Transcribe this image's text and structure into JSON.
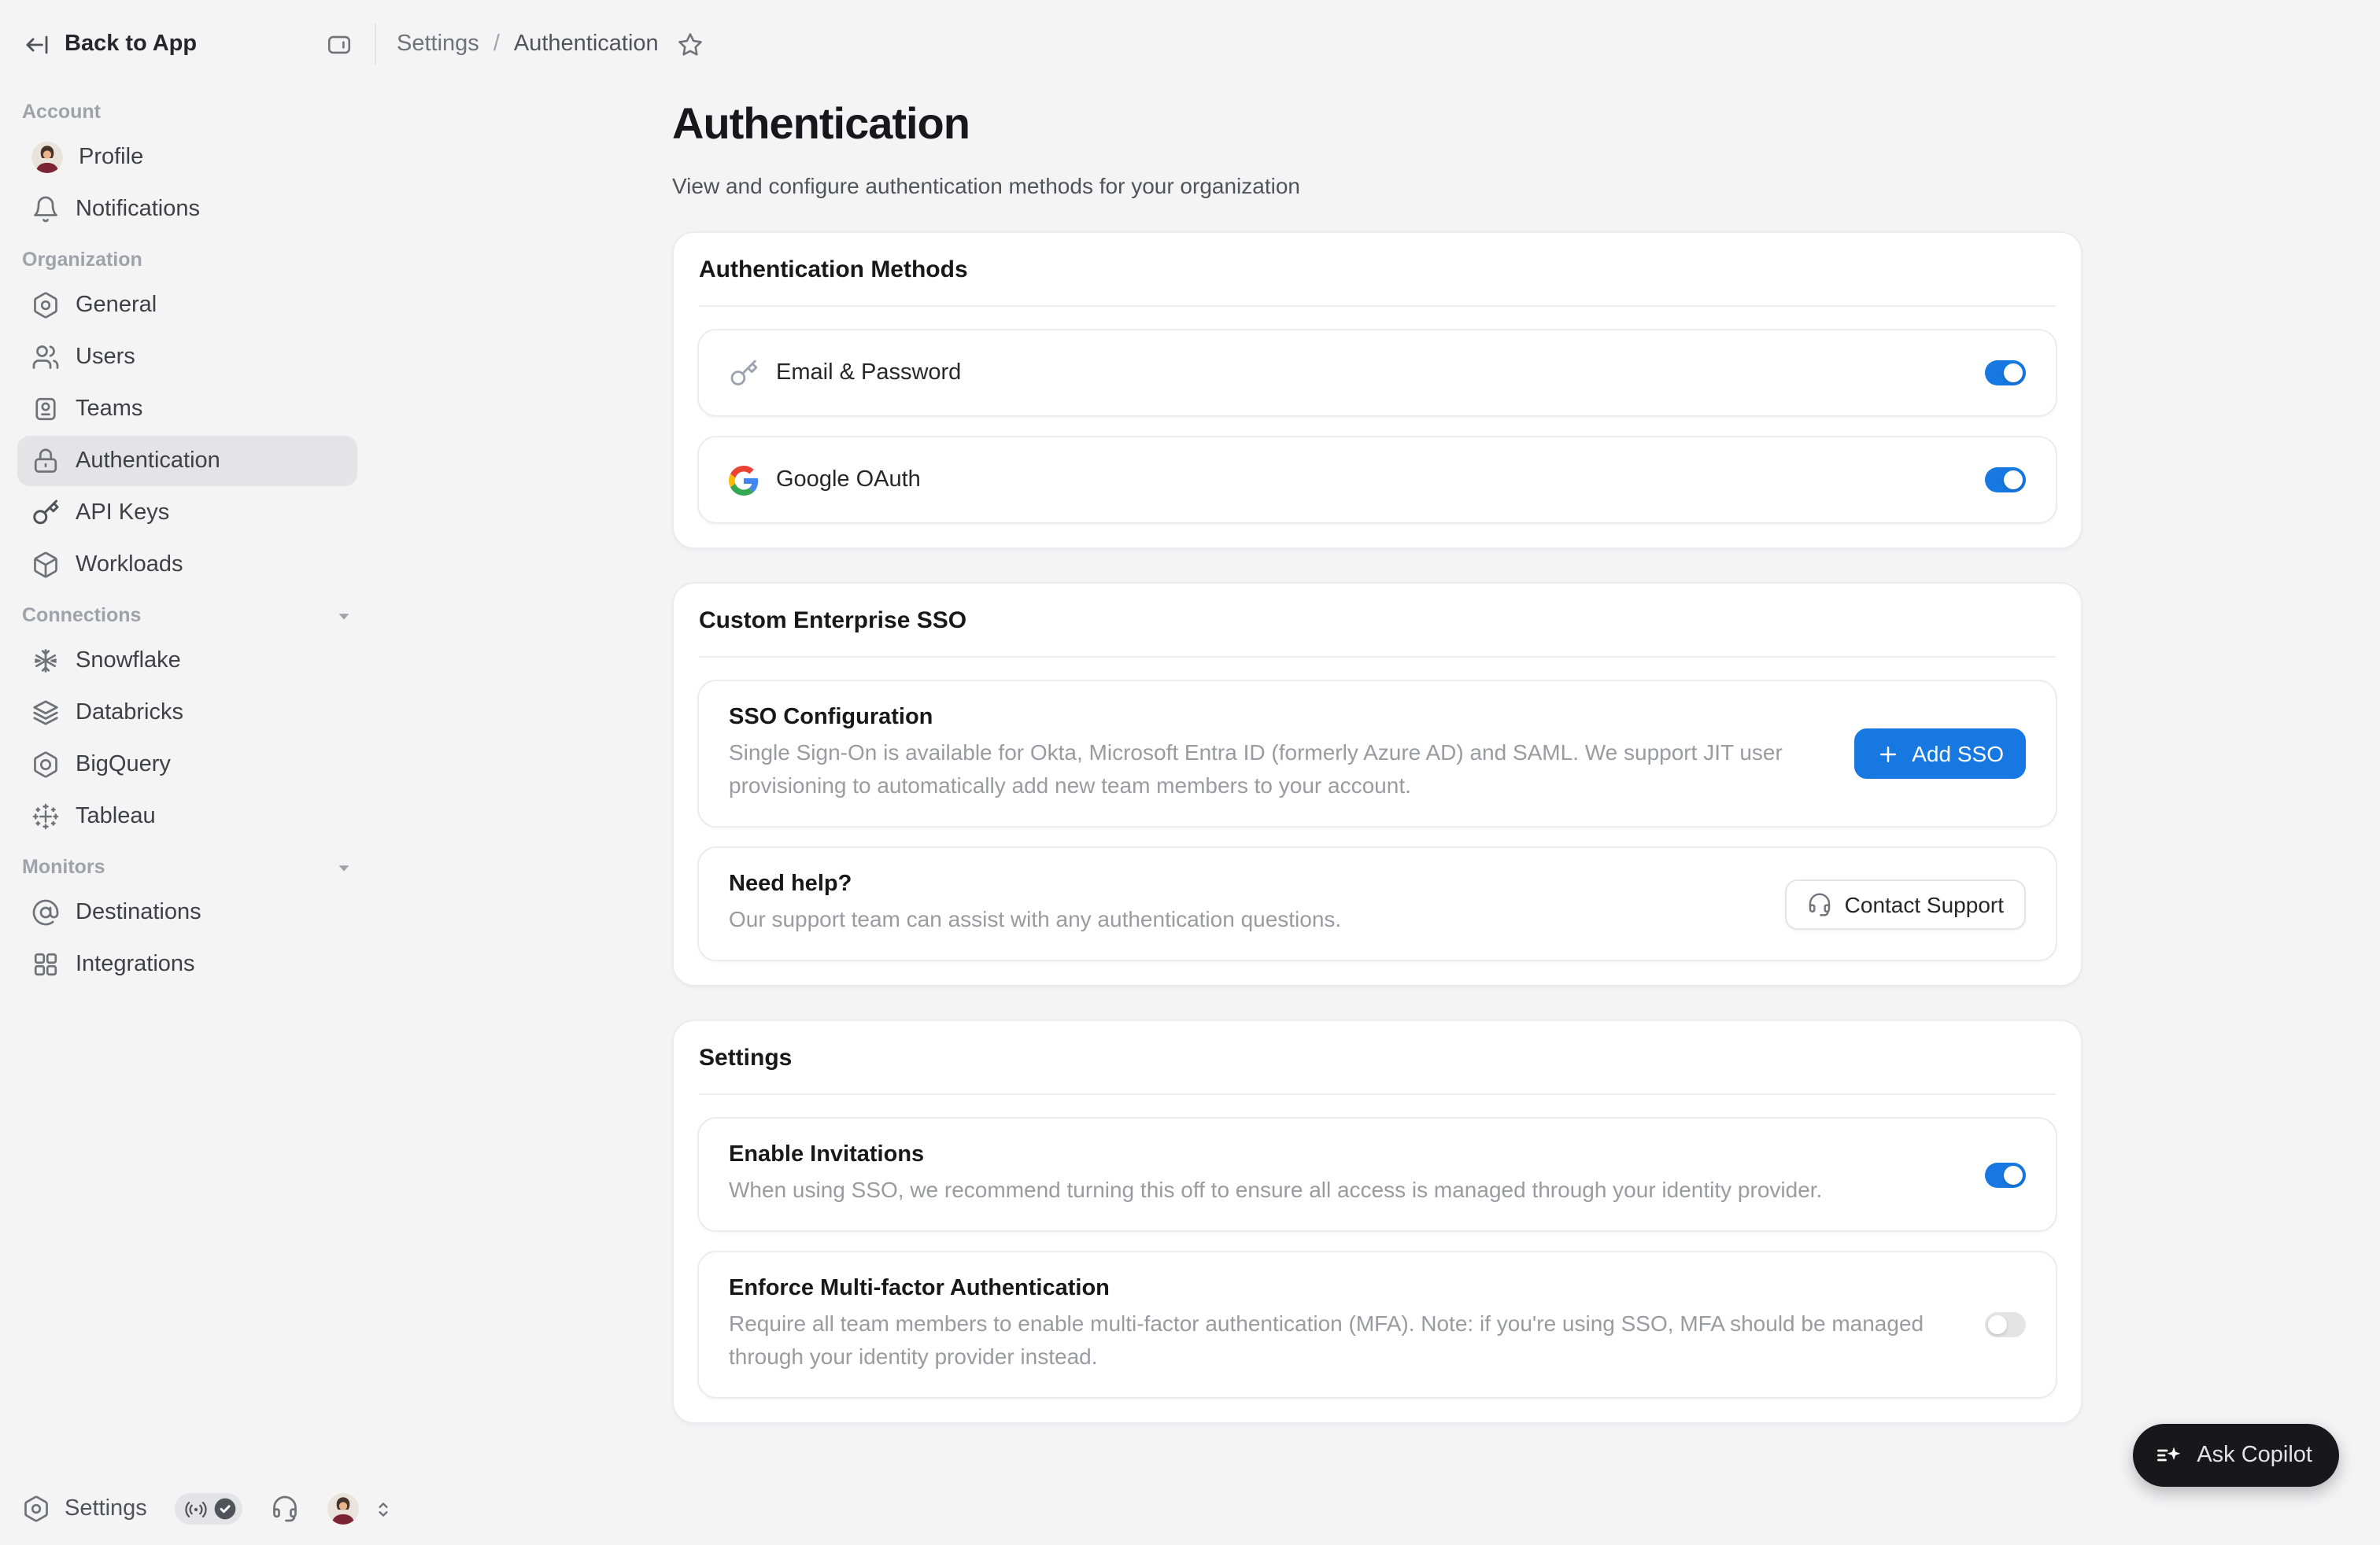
{
  "topbar": {
    "back_label": "Back to App",
    "breadcrumb": {
      "parent": "Settings",
      "separator": "/",
      "current": "Authentication"
    }
  },
  "sidebar": {
    "sections": [
      {
        "label": "Account",
        "items": [
          {
            "label": "Profile",
            "icon": "avatar"
          },
          {
            "label": "Notifications",
            "icon": "bell-icon"
          }
        ]
      },
      {
        "label": "Organization",
        "items": [
          {
            "label": "General",
            "icon": "hexagon-nut-icon"
          },
          {
            "label": "Users",
            "icon": "users-icon"
          },
          {
            "label": "Teams",
            "icon": "id-badge-icon"
          },
          {
            "label": "Authentication",
            "icon": "lock-icon",
            "active": true
          },
          {
            "label": "API Keys",
            "icon": "key-icon"
          },
          {
            "label": "Workloads",
            "icon": "cube-icon"
          }
        ]
      },
      {
        "label": "Connections",
        "collapsible": true,
        "items": [
          {
            "label": "Snowflake",
            "icon": "snowflake-icon"
          },
          {
            "label": "Databricks",
            "icon": "layers-icon"
          },
          {
            "label": "BigQuery",
            "icon": "hexagon-nut-icon"
          },
          {
            "label": "Tableau",
            "icon": "tableau-icon"
          }
        ]
      },
      {
        "label": "Monitors",
        "collapsible": true,
        "items": [
          {
            "label": "Destinations",
            "icon": "at-sign-icon"
          },
          {
            "label": "Integrations",
            "icon": "grid-icon"
          }
        ]
      }
    ],
    "footer": {
      "settings_label": "Settings"
    }
  },
  "main": {
    "title": "Authentication",
    "subtitle": "View and configure authentication methods for your organization",
    "cards": [
      {
        "header": "Authentication Methods",
        "rows": [
          {
            "label": "Email & Password",
            "icon": "key-icon",
            "toggle_on": true
          },
          {
            "label": "Google OAuth",
            "icon": "google-icon",
            "toggle_on": true
          }
        ]
      },
      {
        "header": "Custom Enterprise SSO",
        "rows": [
          {
            "title": "SSO Configuration",
            "desc": "Single Sign-On is available for Okta, Microsoft Entra ID (formerly Azure AD) and SAML. We support JIT user provisioning to automatically add new team members to your account.",
            "button": {
              "label": "Add SSO",
              "icon": "plus-icon",
              "style": "primary"
            }
          },
          {
            "title": "Need help?",
            "desc": "Our support team can assist with any authentication questions.",
            "button": {
              "label": "Contact Support",
              "icon": "headset-icon",
              "style": "secondary"
            }
          }
        ]
      },
      {
        "header": "Settings",
        "rows": [
          {
            "title": "Enable Invitations",
            "desc": "When using SSO, we recommend turning this off to ensure all access is managed through your identity provider.",
            "toggle_on": true
          },
          {
            "title": "Enforce Multi-factor Authentication",
            "desc": "Require all team members to enable multi-factor authentication (MFA). Note: if you're using SSO, MFA should be managed through your identity provider instead.",
            "toggle_on": false
          }
        ]
      }
    ]
  },
  "copilot": {
    "label": "Ask Copilot"
  },
  "colors": {
    "accent": "#1778E2",
    "page_bg": "#F4F4F5",
    "card_bg": "#FFFFFF",
    "toggle_off": "#E4E4E7",
    "copilot_bg": "#18181B",
    "status_check": "#52525B"
  }
}
